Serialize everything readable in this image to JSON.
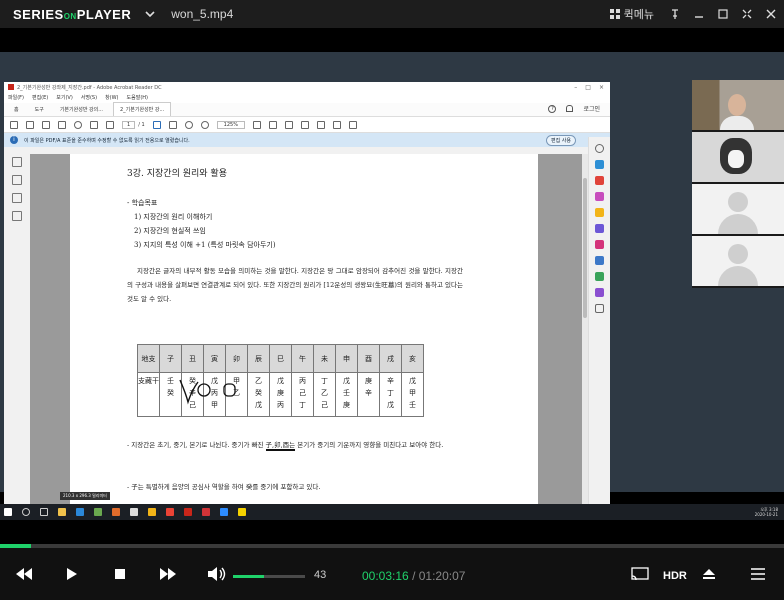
{
  "player": {
    "logo_a": "SERIES",
    "logo_link": "ON",
    "logo_b": "PLAYER",
    "filename": "won_5.mp4",
    "quick_menu": "퀵메뉴",
    "accent": "#1fd26a",
    "volume": "43",
    "volume_fraction": 0.43,
    "progress_fraction": 0.04,
    "time_current": "00:03:16",
    "time_sep": "/",
    "time_total": "01:20:07",
    "hdr": "HDR"
  },
  "acrobat": {
    "title": "2_기본기완성반 강좌제_지장간.pdf - Adobe Acrobat Reader DC",
    "menu": [
      "파일(F)",
      "편집(E)",
      "보기(V)",
      "서명(S)",
      "창(W)",
      "도움말(H)"
    ],
    "tabs": [
      "홈",
      "도구",
      "기본기완성반 강의...",
      "2_기본기완성반 강..."
    ],
    "login": "로그인",
    "page_current": "1",
    "page_total": "/ 1",
    "zoom": "125%",
    "info": "이 파일은 PDF/A 표준을 준수하며 수정할 수 없도록 읽기 전용으로 열렸습니다.",
    "edit_btn": "편집 사용",
    "status": "210.3 x 296.3 밀리미터"
  },
  "doc": {
    "heading": "3강. 지장간의 원리와 활용",
    "objective_title": "- 학습목표",
    "objectives": [
      "1) 지장간의 원리 이해하기",
      "2) 지장간의 현실적 쓰임",
      "3) 지지의 특성 이해 +1 (특성 마릿속 담아두기)"
    ],
    "para1": "지장간은 글자의 내부적 활동 모습을 의미하는 것을 말한다. 지장간은 땅 그대로 암장되어 감추어진 것을 말한다. 지장간의 구성과 내용을 살펴보면 연결관계로 되어 있다. 또한 지장간의 원리가 [12운성의 생왕묘(生旺墓)의 원리와 통하고 있다는 것도 알 수 있다.",
    "table_head": [
      "地支",
      "子",
      "丑",
      "寅",
      "卯",
      "辰",
      "巳",
      "午",
      "未",
      "申",
      "酉",
      "戌",
      "亥"
    ],
    "table_body": [
      "支藏干",
      "壬 癸",
      "癸 辛 己",
      "戊 丙 甲",
      "甲 乙",
      "乙 癸 戊",
      "戊 庚 丙",
      "丙 己 丁",
      "丁 乙 己",
      "戊 壬 庚",
      "庚 辛",
      "辛 丁 戊",
      "戊 甲 壬"
    ],
    "para2_a": "- 지장간은 초기, 중기, 본기로 나뉜다. 중기가 빠진 ",
    "para2_u": "子,卯,酉는",
    "para2_b": " 본기가 중기의 기운까지 영향을 미친다고 보아야 한다.",
    "para3": "- 子는 특별하게 음양의 공심사 역할을 하여 癸를 중기에 포함하고 있다."
  },
  "taskbar": {
    "clock_time": "오후 3:18",
    "clock_date": "2020-10-21"
  }
}
